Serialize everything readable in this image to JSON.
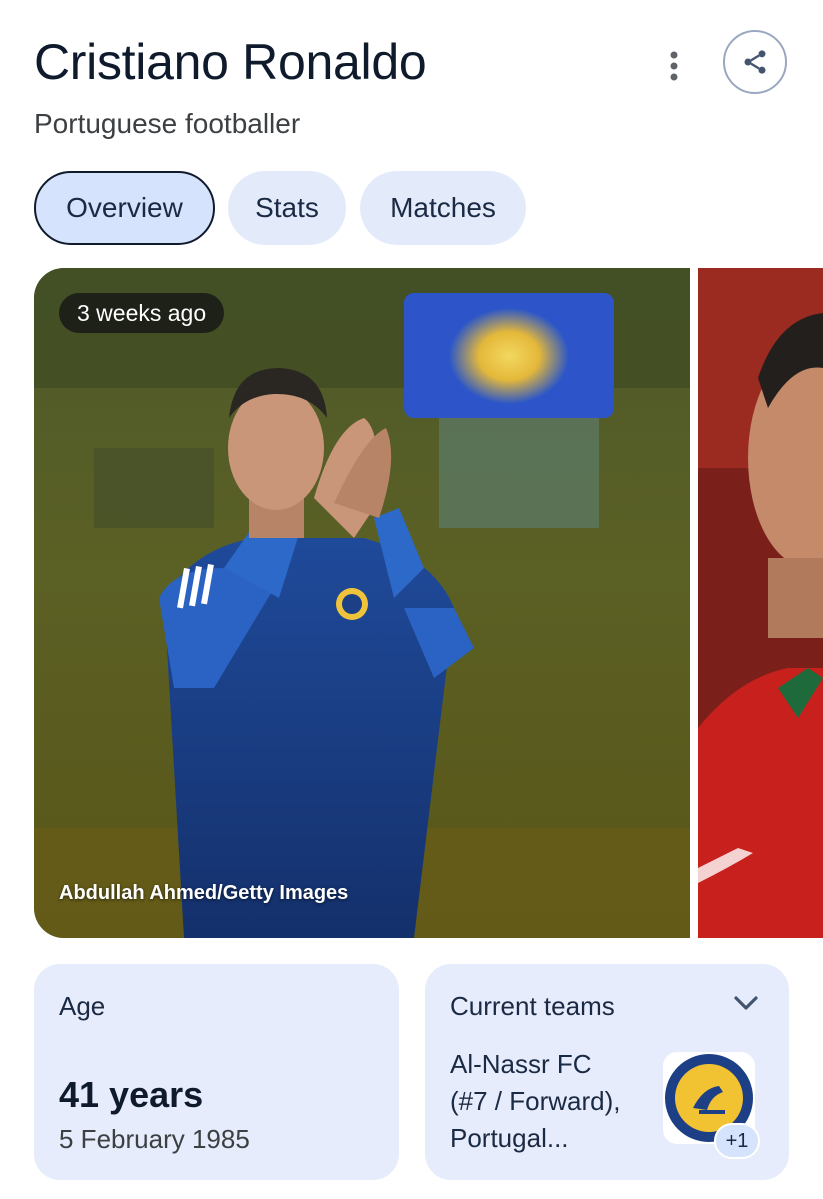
{
  "header": {
    "title": "Cristiano Ronaldo",
    "subtitle": "Portuguese footballer",
    "menu_icon": "more-vert-icon",
    "share_icon": "share-icon"
  },
  "tabs": [
    {
      "label": "Overview",
      "active": true
    },
    {
      "label": "Stats",
      "active": false
    },
    {
      "label": "Matches",
      "active": false
    }
  ],
  "photos": {
    "main": {
      "time_badge": "3 weeks ago",
      "credit": "Abdullah Ahmed/Getty Images"
    }
  },
  "cards": {
    "age": {
      "label": "Age",
      "value": "41 years",
      "date_of_birth": "5 February 1985"
    },
    "teams": {
      "label": "Current teams",
      "line1": "Al-Nassr FC",
      "line2": "(#7 / Forward),",
      "line3": "Portugal...",
      "logo_label": "NASSR",
      "more_count": "+1",
      "chevron_icon": "chevron-down-icon"
    }
  },
  "colors": {
    "tab_bg": "#e3ebfb",
    "tab_active_bg": "#d6e3fc",
    "card_bg": "#e6ecfb",
    "title_text": "#0f1b2d"
  }
}
